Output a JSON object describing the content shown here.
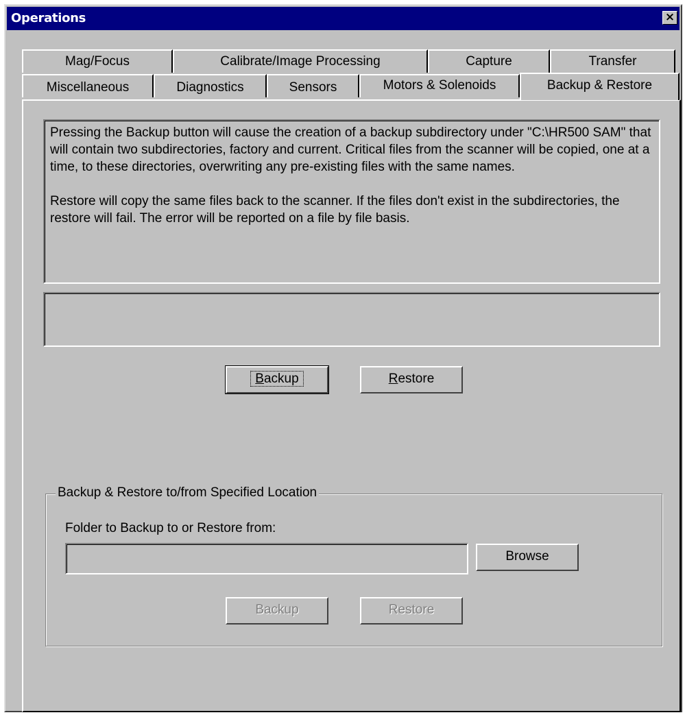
{
  "window": {
    "title": "Operations",
    "close_label": "×"
  },
  "tabs_row_back": [
    {
      "label": "Mag/Focus"
    },
    {
      "label": "Calibrate/Image Processing"
    },
    {
      "label": "Capture"
    },
    {
      "label": "Transfer"
    }
  ],
  "tabs_row_front": [
    {
      "label": "Miscellaneous"
    },
    {
      "label": "Diagnostics"
    },
    {
      "label": "Sensors"
    },
    {
      "label": "Motors & Solenoids"
    },
    {
      "label": "Backup & Restore",
      "active": true
    }
  ],
  "info": {
    "paragraph1": "Pressing the Backup button will cause the creation of a backup subdirectory under \"C:\\HR500 SAM\"  that will contain two subdirectories, factory and current.  Critical files from the scanner will be copied, one at a time, to these directories, overwriting any pre-existing files with the same names.",
    "paragraph2": "Restore will copy the same files back to the scanner.  If the files don't exist in the subdirectories, the restore will fail.  The error will be reported on a file by file basis."
  },
  "status_box": {
    "text": ""
  },
  "main_buttons": {
    "backup_rest": "ackup",
    "backup_first": "B",
    "restore_rest": "estore",
    "restore_first": "R"
  },
  "location_group": {
    "legend": "Backup & Restore to/from Specified Location",
    "folder_label": "Folder to Backup to or Restore from:",
    "folder_value": "",
    "browse_label": "Browse",
    "backup_label": "Backup",
    "restore_label": "Restore",
    "backup_enabled": false,
    "restore_enabled": false
  }
}
